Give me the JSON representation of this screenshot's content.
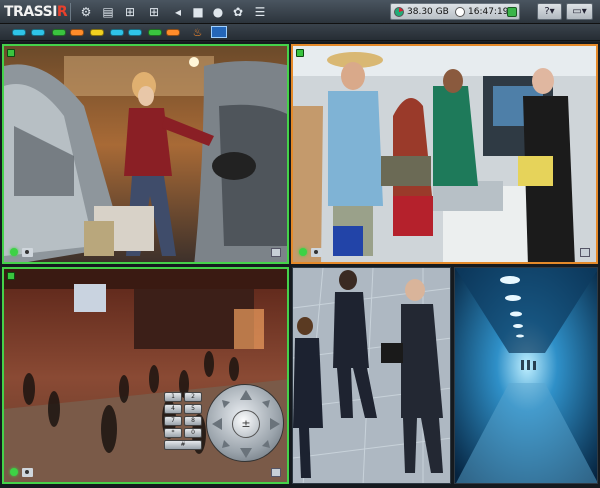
{
  "app": {
    "logo_main": "TRASSI",
    "logo_accent": "R"
  },
  "status": {
    "disk_free": "38.30 GB",
    "time": "16:47:19"
  },
  "toolbar": {
    "icons": [
      "settings-icon",
      "archive-icon",
      "layout-4-icon",
      "layout-9-icon",
      "sound-icon",
      "stop-icon",
      "record-icon",
      "people-icon",
      "list-icon"
    ],
    "help_label": "?"
  },
  "channels": {
    "pill_colors": [
      "#2fc4e8",
      "#2fc4e8",
      "#3ac43f",
      "#ff8c2a",
      "#f0d020",
      "#2fc4e8",
      "#2fc4e8",
      "#3ac43f",
      "#ff8c2a"
    ]
  },
  "ptz": {
    "keys": [
      "1",
      "2",
      "3",
      "4",
      "5",
      "6",
      "7",
      "8",
      "9",
      "*",
      "0",
      "#"
    ],
    "zoom_label": "±"
  }
}
